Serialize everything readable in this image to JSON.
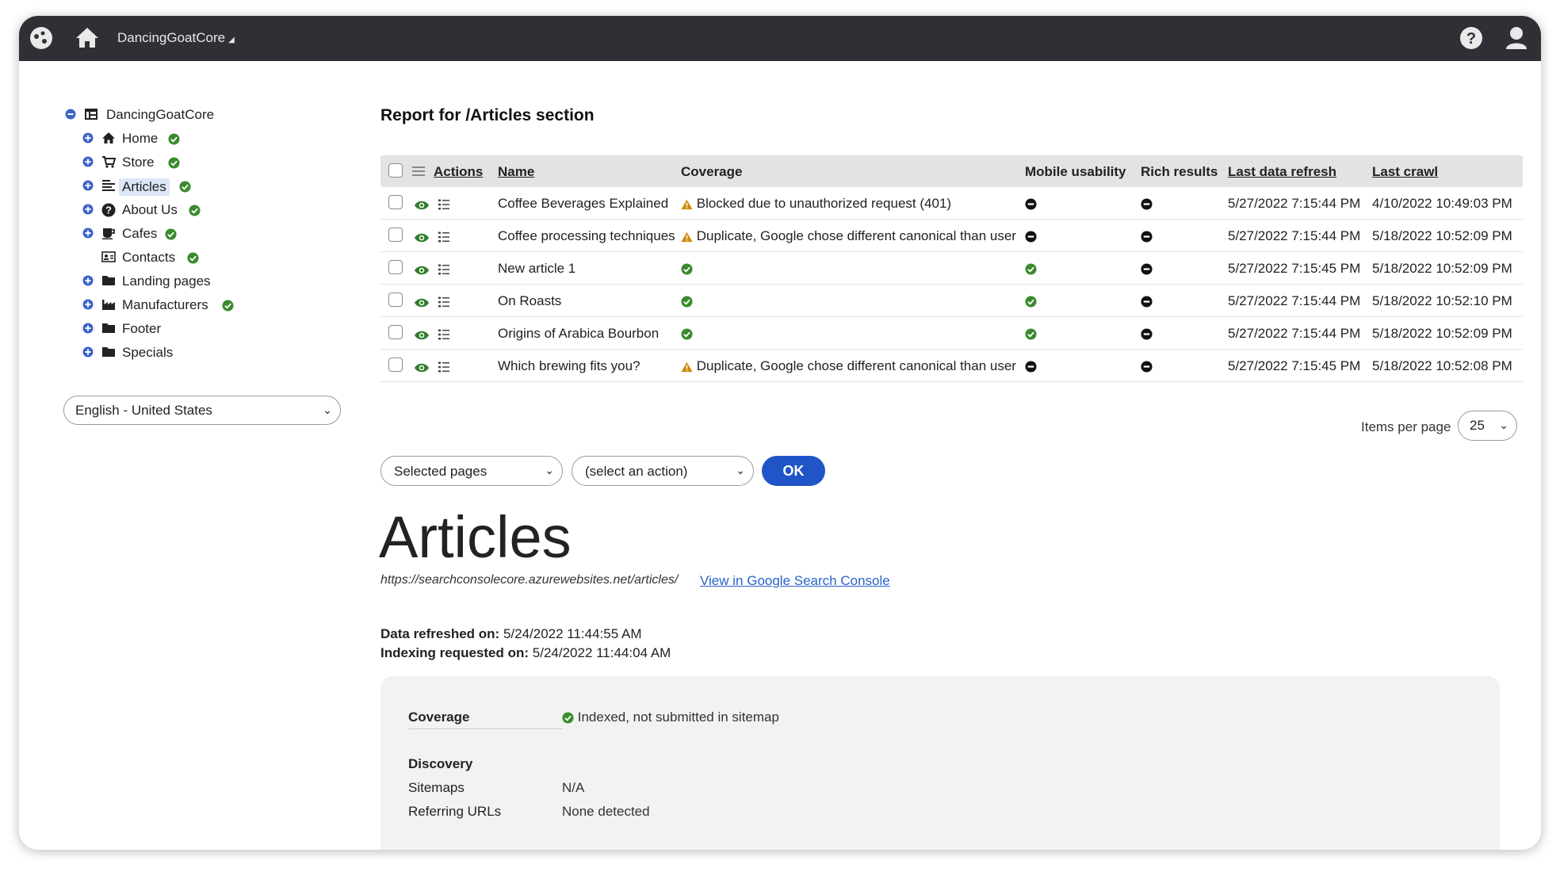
{
  "colors": {
    "topbar": "#2f3035",
    "accent": "#1f55c7",
    "success": "#3b8a2e",
    "warning": "#d08a00",
    "link": "#2a62c9"
  },
  "topbar": {
    "site_name": "DancingGoatCore",
    "site_caret": "◢"
  },
  "tree": {
    "root": {
      "label": "DancingGoatCore",
      "icon": "table-icon"
    },
    "items": [
      {
        "label": "Home",
        "icon": "home-icon",
        "expandable": true,
        "published": true
      },
      {
        "label": "Store",
        "icon": "cart-icon",
        "expandable": true,
        "published": true
      },
      {
        "label": "Articles",
        "icon": "list-icon",
        "expandable": true,
        "published": true,
        "selected": true
      },
      {
        "label": "About Us",
        "icon": "question-icon",
        "expandable": true,
        "published": true
      },
      {
        "label": "Cafes",
        "icon": "coffee-icon",
        "expandable": true,
        "published": true
      },
      {
        "label": "Contacts",
        "icon": "contact-card-icon",
        "expandable": false,
        "published": true
      },
      {
        "label": "Landing pages",
        "icon": "folder-icon",
        "expandable": true,
        "published": false
      },
      {
        "label": "Manufacturers",
        "icon": "factory-icon",
        "expandable": true,
        "published": true
      },
      {
        "label": "Footer",
        "icon": "folder-icon",
        "expandable": true,
        "published": false
      },
      {
        "label": "Specials",
        "icon": "folder-icon",
        "expandable": true,
        "published": false
      }
    ]
  },
  "language": {
    "selected": "English - United States"
  },
  "report": {
    "title": "Report for /Articles section",
    "columns": {
      "actions": "Actions",
      "name": "Name",
      "coverage": "Coverage",
      "mobile": "Mobile usability",
      "rich": "Rich results",
      "refresh": "Last data refresh",
      "crawl": "Last crawl"
    },
    "rows": [
      {
        "name": "Coffee Beverages Explained",
        "coverage_status": "warning",
        "coverage_text": "Blocked due to unauthorized request (401)",
        "mobile": "neutral",
        "rich": "neutral",
        "refresh": "5/27/2022 7:15:44 PM",
        "crawl": "4/10/2022 10:49:03 PM"
      },
      {
        "name": "Coffee processing techniques",
        "coverage_status": "warning",
        "coverage_text": "Duplicate, Google chose different canonical than user",
        "mobile": "neutral",
        "rich": "neutral",
        "refresh": "5/27/2022 7:15:44 PM",
        "crawl": "5/18/2022 10:52:09 PM"
      },
      {
        "name": "New article 1",
        "coverage_status": "ok",
        "coverage_text": "",
        "mobile": "ok",
        "rich": "neutral",
        "refresh": "5/27/2022 7:15:45 PM",
        "crawl": "5/18/2022 10:52:09 PM"
      },
      {
        "name": "On Roasts",
        "coverage_status": "ok",
        "coverage_text": "",
        "mobile": "ok",
        "rich": "neutral",
        "refresh": "5/27/2022 7:15:44 PM",
        "crawl": "5/18/2022 10:52:10 PM"
      },
      {
        "name": "Origins of Arabica Bourbon",
        "coverage_status": "ok",
        "coverage_text": "",
        "mobile": "ok",
        "rich": "neutral",
        "refresh": "5/27/2022 7:15:44 PM",
        "crawl": "5/18/2022 10:52:09 PM"
      },
      {
        "name": "Which brewing fits you?",
        "coverage_status": "warning",
        "coverage_text": "Duplicate, Google chose different canonical than user",
        "mobile": "neutral",
        "rich": "neutral",
        "refresh": "5/27/2022 7:15:45 PM",
        "crawl": "5/18/2022 10:52:08 PM"
      }
    ],
    "items_per_page_label": "Items per page",
    "items_per_page_value": "25"
  },
  "bulk": {
    "scope": "Selected pages",
    "action": "(select an action)",
    "ok_label": "OK"
  },
  "detail": {
    "title": "Articles",
    "url": "https://searchconsolecore.azurewebsites.net/articles/",
    "gsc_link": "View in Google Search Console",
    "refreshed_label": "Data refreshed on:",
    "refreshed_value": "5/24/2022 11:44:55 AM",
    "indexing_label": "Indexing requested on:",
    "indexing_value": "5/24/2022 11:44:04 AM",
    "coverage_label": "Coverage",
    "coverage_value": "Indexed, not submitted in sitemap",
    "discovery_label": "Discovery",
    "sitemaps_label": "Sitemaps",
    "sitemaps_value": "N/A",
    "referring_label": "Referring URLs",
    "referring_value": "None detected"
  }
}
